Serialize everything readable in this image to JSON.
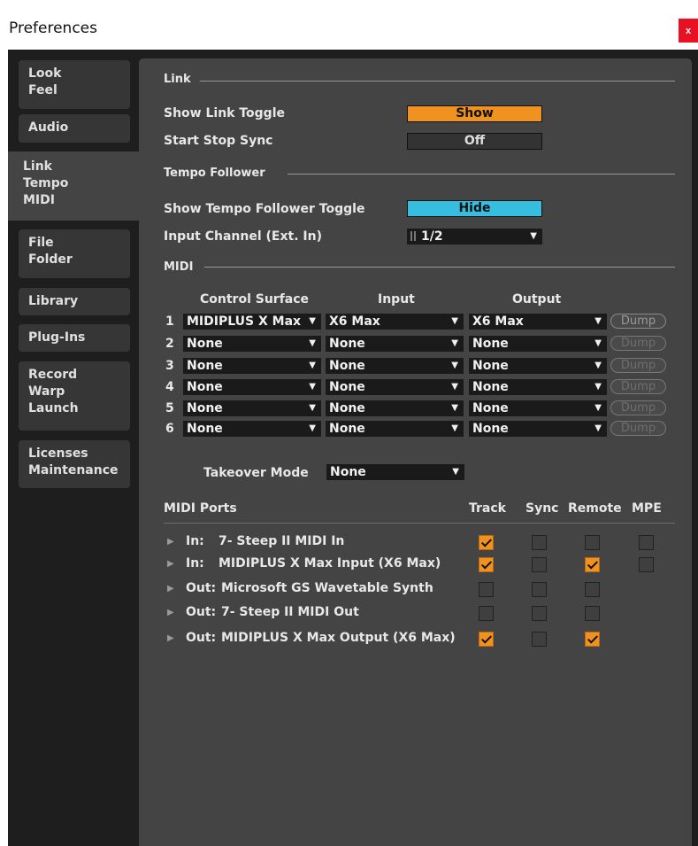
{
  "window": {
    "title": "Preferences",
    "close_label": "x"
  },
  "sidebar": {
    "items": [
      {
        "lines": [
          "Look",
          "Feel"
        ]
      },
      {
        "lines": [
          "Audio"
        ]
      },
      {
        "lines": [
          "Link",
          "Tempo",
          "MIDI"
        ]
      },
      {
        "lines": [
          "File",
          "Folder"
        ]
      },
      {
        "lines": [
          "Library"
        ]
      },
      {
        "lines": [
          "Plug-Ins"
        ]
      },
      {
        "lines": [
          "Record",
          "Warp",
          "Launch"
        ]
      },
      {
        "lines": [
          "Licenses",
          "Maintenance"
        ]
      }
    ],
    "active_index": 2
  },
  "link": {
    "section": "Link",
    "show_toggle_label": "Show Link Toggle",
    "show_toggle_value": "Show",
    "start_stop_label": "Start Stop Sync",
    "start_stop_value": "Off"
  },
  "tempo": {
    "section": "Tempo Follower",
    "toggle_label": "Show Tempo Follower Toggle",
    "toggle_value": "Hide",
    "channel_label": "Input Channel (Ext. In)",
    "channel_value": "1/2"
  },
  "midi": {
    "section": "MIDI",
    "headers": {
      "surface": "Control Surface",
      "input": "Input",
      "output": "Output"
    },
    "dump_label": "Dump",
    "rows": [
      {
        "num": "1",
        "surface": "MIDIPLUS X Max",
        "input": "X6 Max",
        "output": "X6 Max"
      },
      {
        "num": "2",
        "surface": "None",
        "input": "None",
        "output": "None"
      },
      {
        "num": "3",
        "surface": "None",
        "input": "None",
        "output": "None"
      },
      {
        "num": "4",
        "surface": "None",
        "input": "None",
        "output": "None"
      },
      {
        "num": "5",
        "surface": "None",
        "input": "None",
        "output": "None"
      },
      {
        "num": "6",
        "surface": "None",
        "input": "None",
        "output": "None"
      }
    ],
    "takeover_label": "Takeover Mode",
    "takeover_value": "None"
  },
  "ports": {
    "title": "MIDI Ports",
    "columns": [
      "Track",
      "Sync",
      "Remote",
      "MPE"
    ],
    "rows": [
      {
        "dir": "In:",
        "name": "7- Steep II MIDI In",
        "track": true,
        "sync": false,
        "remote": false,
        "mpe": false
      },
      {
        "dir": "In:",
        "name": "MIDIPLUS X Max Input (X6 Max)",
        "track": true,
        "sync": false,
        "remote": true,
        "mpe": false
      },
      {
        "dir": "Out:",
        "name": "Microsoft GS Wavetable Synth",
        "track": false,
        "sync": false,
        "remote": false,
        "mpe": null
      },
      {
        "dir": "Out:",
        "name": "7- Steep II MIDI Out",
        "track": false,
        "sync": false,
        "remote": false,
        "mpe": null
      },
      {
        "dir": "Out:",
        "name": "MIDIPLUS X Max Output (X6 Max)",
        "track": true,
        "sync": false,
        "remote": true,
        "mpe": null
      }
    ]
  },
  "colors": {
    "accent_orange": "#f0921f",
    "accent_cyan": "#36bde0",
    "panel": "#444444",
    "background": "#1e1e1e"
  }
}
